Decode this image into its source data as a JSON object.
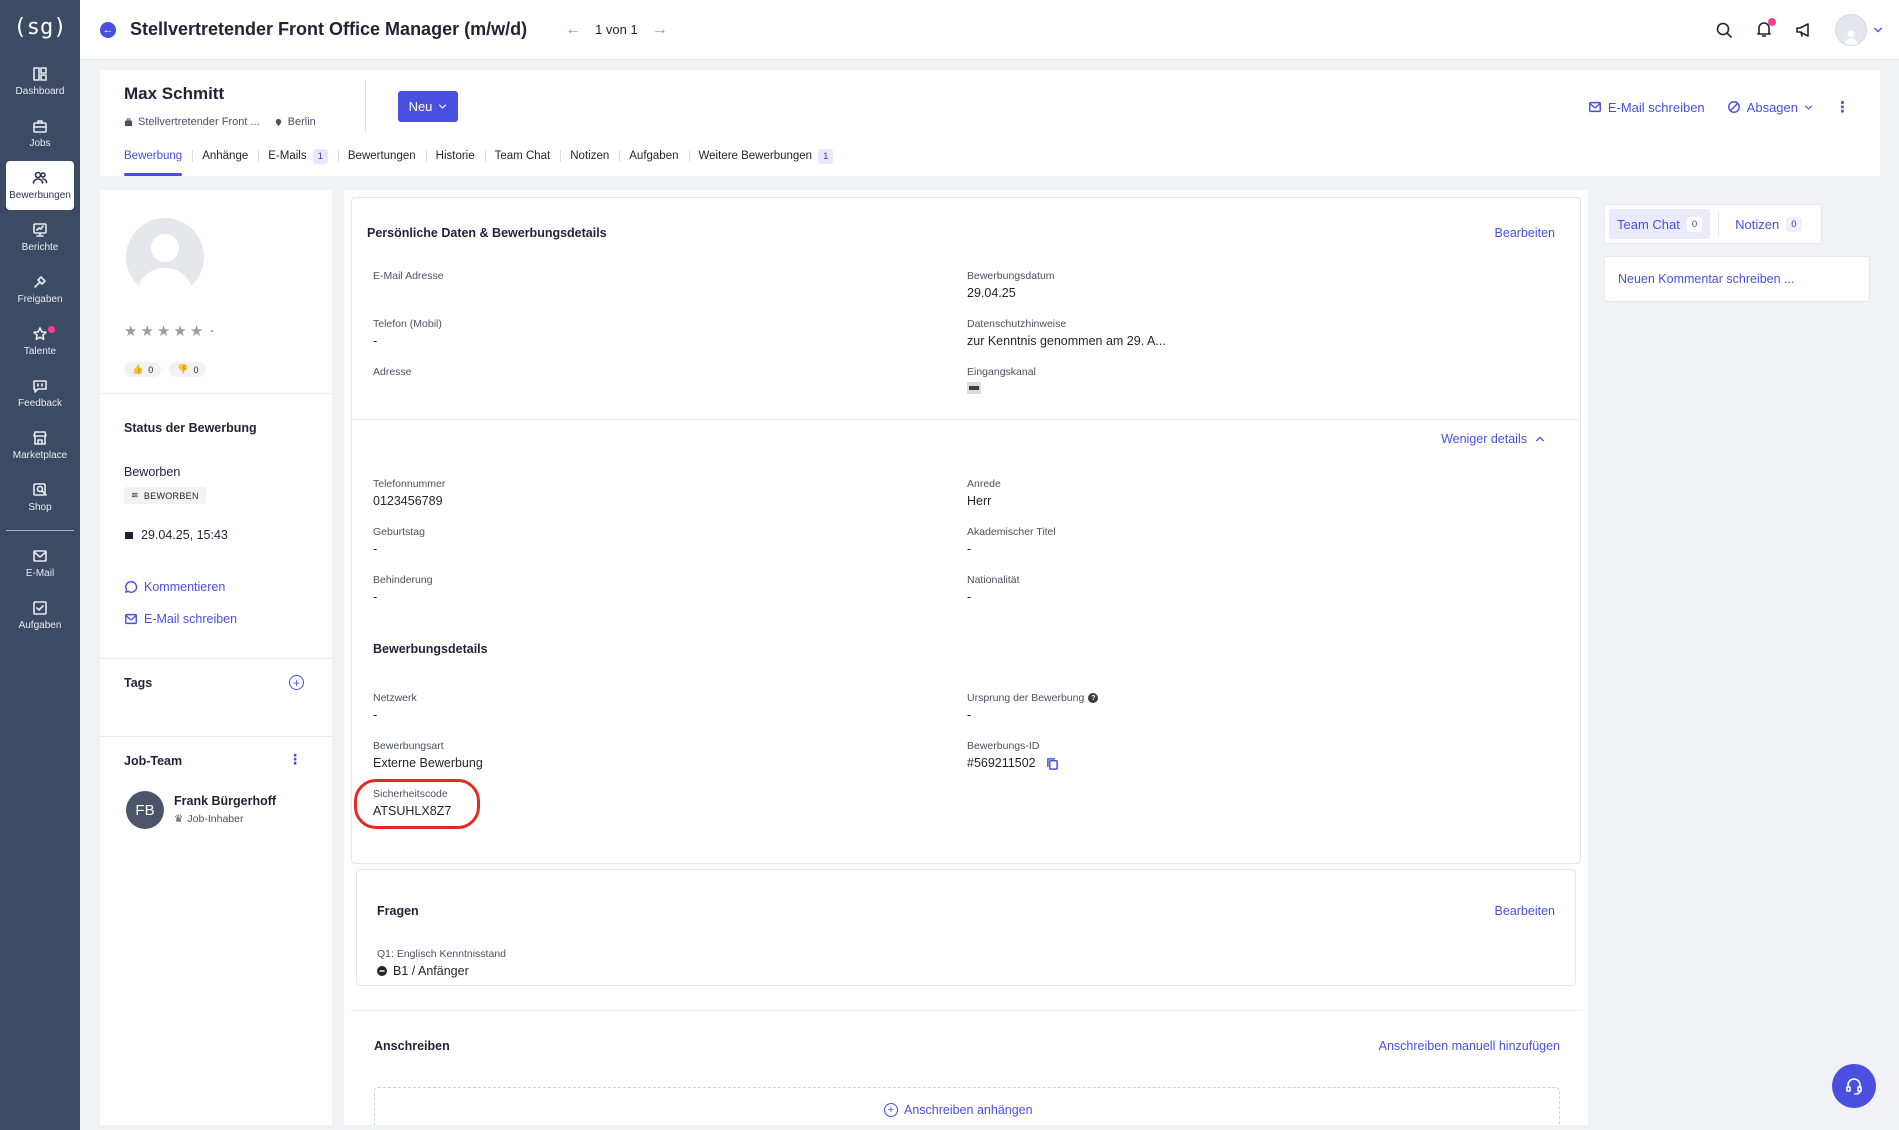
{
  "app": {
    "logo": "(sg)"
  },
  "sidebar": {
    "items": [
      {
        "label": "Dashboard",
        "icon": "dashboard-icon"
      },
      {
        "label": "Jobs",
        "icon": "briefcase-icon"
      },
      {
        "label": "Bewerbungen",
        "icon": "users-icon",
        "active": true
      },
      {
        "label": "Berichte",
        "icon": "report-icon"
      },
      {
        "label": "Freigaben",
        "icon": "approval-icon"
      },
      {
        "label": "Talente",
        "icon": "star-icon"
      },
      {
        "label": "Feedback",
        "icon": "feedback-icon"
      },
      {
        "label": "Marketplace",
        "icon": "store-icon"
      },
      {
        "label": "Shop",
        "icon": "shop-icon"
      },
      {
        "label": "E-Mail",
        "icon": "mail-icon"
      },
      {
        "label": "Aufgaben",
        "icon": "checkbox-icon"
      }
    ]
  },
  "topbar": {
    "job_title": "Stellvertretender Front Office Manager (m/w/d)",
    "pager": "1 von 1"
  },
  "candidate": {
    "name": "Max Schmitt",
    "job_short": "Stellvertretender Front ...",
    "location": "Berlin",
    "status_button": "Neu",
    "email_action": "E-Mail schreiben",
    "reject_action": "Absagen"
  },
  "tabs": [
    {
      "label": "Bewerbung",
      "active": true
    },
    {
      "label": "Anhänge"
    },
    {
      "label": "E-Mails",
      "badge": "1"
    },
    {
      "label": "Bewertungen"
    },
    {
      "label": "Historie"
    },
    {
      "label": "Team Chat"
    },
    {
      "label": "Notizen"
    },
    {
      "label": "Aufgaben"
    },
    {
      "label": "Weitere Bewerbungen",
      "badge": "1"
    }
  ],
  "left": {
    "rating_value": "-",
    "thumbs_up": "0",
    "thumbs_down": "0",
    "status_title": "Status der Bewerbung",
    "status_value": "Beworben",
    "status_chip": "BEWORBEN",
    "status_date": "29.04.25, 15:43",
    "comment_link": "Kommentieren",
    "email_link": "E-Mail schreiben",
    "tags_title": "Tags",
    "team_title": "Job-Team",
    "member_initials": "FB",
    "member_name": "Frank Bürgerhoff",
    "member_role": "Job-Inhaber"
  },
  "personal": {
    "title": "Persönliche Daten & Bewerbungsdetails",
    "edit": "Bearbeiten",
    "fields": {
      "email_label": "E-Mail Adresse",
      "email_value": "",
      "date_label": "Bewerbungsdatum",
      "date_value": "29.04.25",
      "phone_label": "Telefon (Mobil)",
      "phone_value": "-",
      "privacy_label": "Datenschutzhinweise",
      "privacy_value": "zur Kenntnis genommen am 29. A...",
      "address_label": "Adresse",
      "channel_label": "Eingangskanal"
    },
    "less_details": "Weniger details",
    "more": {
      "tel_label": "Telefonnummer",
      "tel_value": "0123456789",
      "salutation_label": "Anrede",
      "salutation_value": "Herr",
      "birthday_label": "Geburtstag",
      "birthday_value": "-",
      "acad_label": "Akademischer Titel",
      "acad_value": "-",
      "disability_label": "Behinderung",
      "disability_value": "-",
      "nationality_label": "Nationalität",
      "nationality_value": "-"
    },
    "details_title": "Bewerbungsdetails",
    "details": {
      "network_label": "Netzwerk",
      "network_value": "-",
      "origin_label": "Ursprung der Bewerbung",
      "origin_value": "-",
      "type_label": "Bewerbungsart",
      "type_value": "Externe Bewerbung",
      "id_label": "Bewerbungs-ID",
      "id_value": "#569211502",
      "code_label": "Sicherheitscode",
      "code_value": "ATSUHLX8Z7"
    }
  },
  "questions": {
    "title": "Fragen",
    "edit": "Bearbeiten",
    "q1_label": "Q1: Englisch Kenntnisstand",
    "q1_value": "B1 / Anfänger"
  },
  "cover": {
    "title": "Anschreiben",
    "add_manual": "Anschreiben manuell hinzufügen",
    "attach": "Anschreiben anhängen"
  },
  "right": {
    "team_chat": "Team Chat",
    "team_chat_count": "0",
    "notes": "Notizen",
    "notes_count": "0",
    "comment_placeholder": "Neuen Kommentar schreiben ..."
  },
  "colors": {
    "accent": "#4a4fe0",
    "sidebar": "#3d4a63",
    "highlight": "#e52b1f",
    "notification": "#ff3d8b"
  }
}
